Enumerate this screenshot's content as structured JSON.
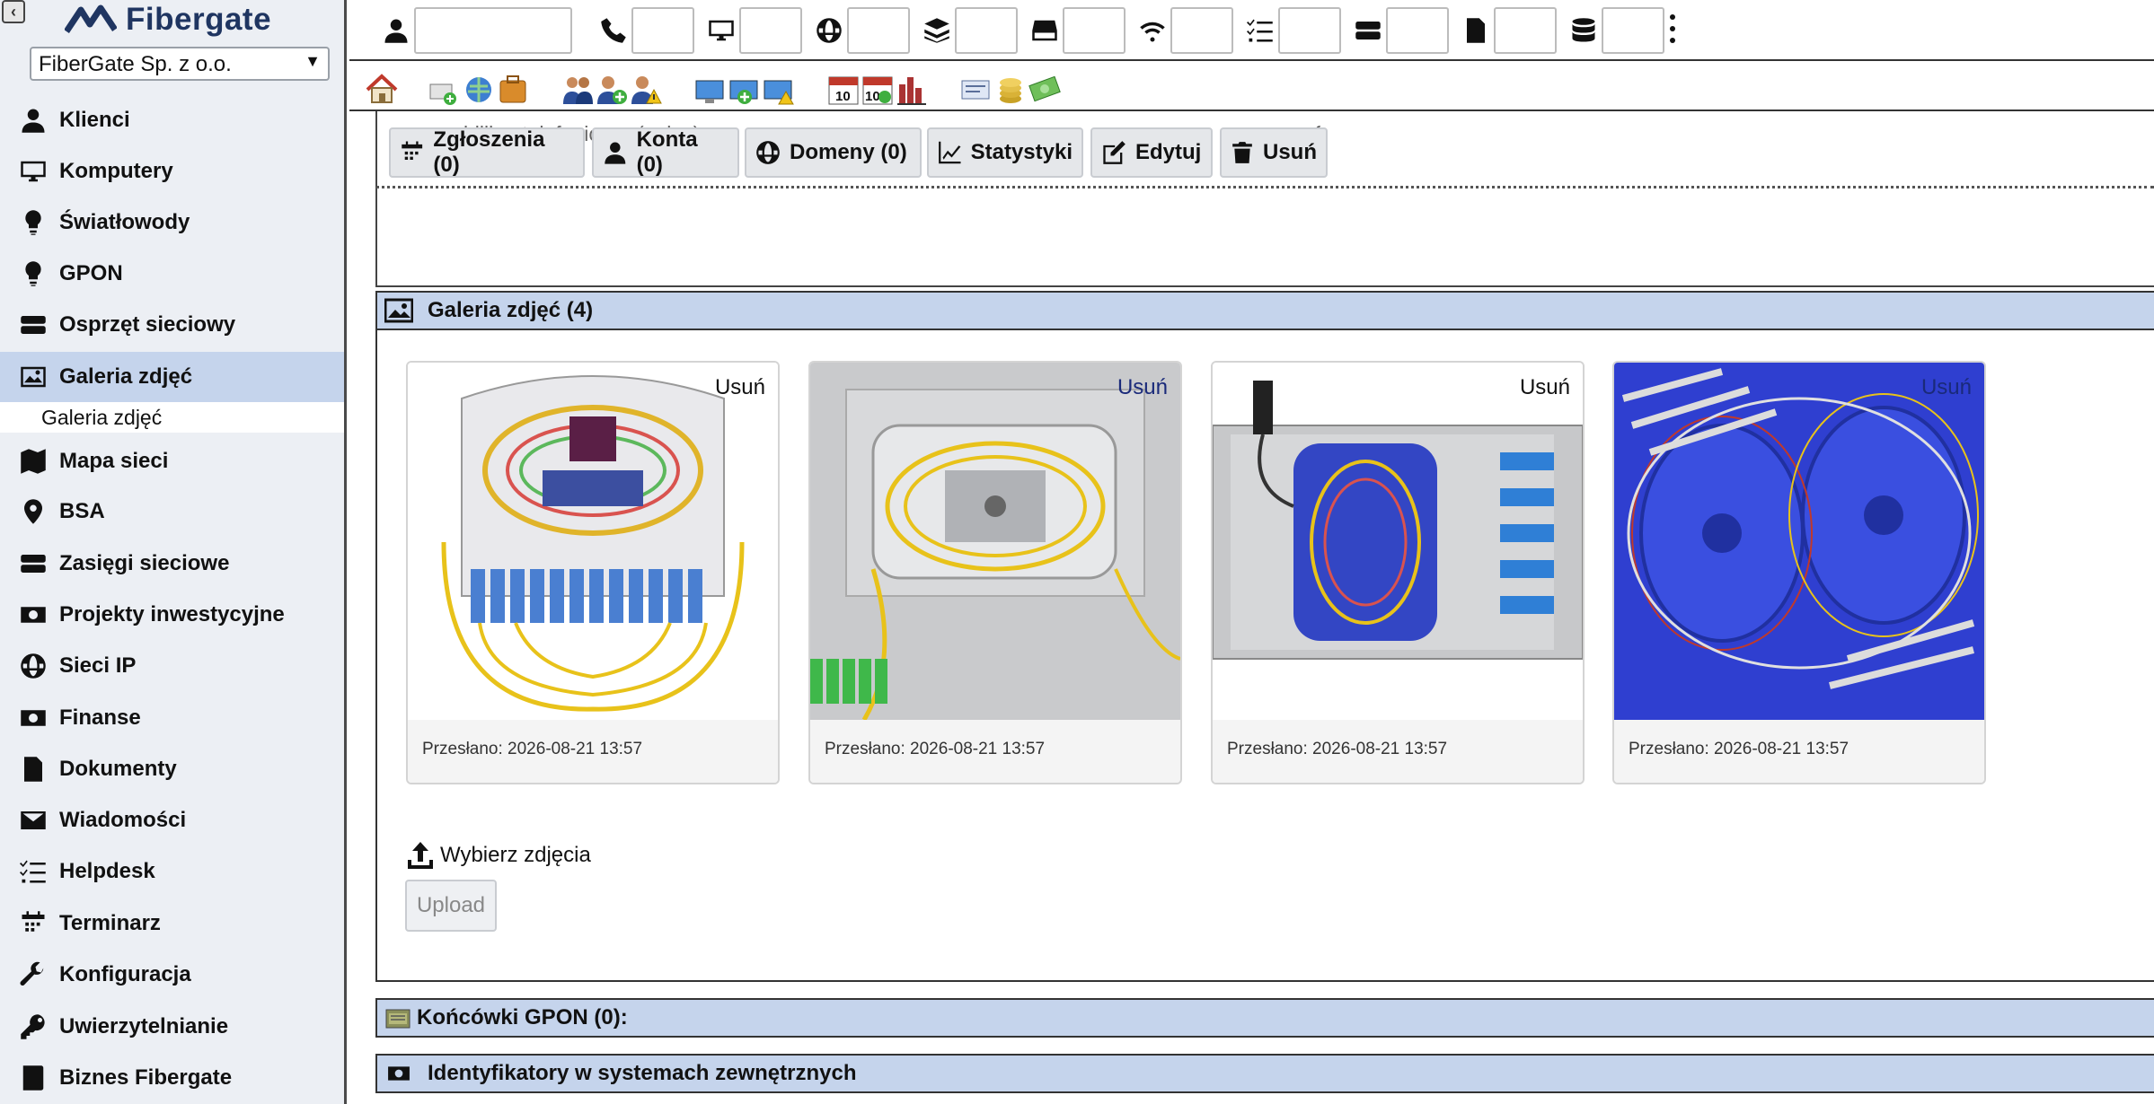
{
  "brand": {
    "name": "Fibergate",
    "collapse_icon": "collapse-left-icon"
  },
  "company_select": {
    "value": "FiberGate Sp. z o.o."
  },
  "sidebar": {
    "items": [
      {
        "label": "Klienci",
        "icon": "user-icon"
      },
      {
        "label": "Komputery",
        "icon": "monitor-icon"
      },
      {
        "label": "Światłowody",
        "icon": "bulb-icon"
      },
      {
        "label": "GPON",
        "icon": "bulb-icon"
      },
      {
        "label": "Osprzęt sieciowy",
        "icon": "server-icon"
      },
      {
        "label": "Galeria zdjęć",
        "icon": "image-icon",
        "active": true
      },
      {
        "label": "Mapa sieci",
        "icon": "map-icon"
      },
      {
        "label": "BSA",
        "icon": "pin-icon"
      },
      {
        "label": "Zasięgi sieciowe",
        "icon": "server-icon"
      },
      {
        "label": "Projekty inwestycyjne",
        "icon": "money-icon"
      },
      {
        "label": "Sieci IP",
        "icon": "globe-icon"
      },
      {
        "label": "Finanse",
        "icon": "money-icon"
      },
      {
        "label": "Dokumenty",
        "icon": "document-icon"
      },
      {
        "label": "Wiadomości",
        "icon": "envelope-icon"
      },
      {
        "label": "Helpdesk",
        "icon": "checklist-icon"
      },
      {
        "label": "Terminarz",
        "icon": "calendar-icon"
      },
      {
        "label": "Konfiguracja",
        "icon": "wrench-icon"
      },
      {
        "label": "Uwierzytelnianie",
        "icon": "key-icon"
      },
      {
        "label": "Biznes Fibergate",
        "icon": "book-icon"
      }
    ],
    "subitem": "Galeria zdjęć"
  },
  "topbar": {
    "fields": [
      {
        "icon": "user-icon",
        "value": ""
      },
      {
        "icon": "phone-icon",
        "value": ""
      },
      {
        "icon": "monitor-icon",
        "value": ""
      },
      {
        "icon": "globe-icon",
        "value": ""
      },
      {
        "icon": "layers-icon",
        "value": ""
      },
      {
        "icon": "hdd-icon",
        "value": ""
      },
      {
        "icon": "wifi-icon",
        "value": ""
      },
      {
        "icon": "checklist-icon",
        "value": ""
      },
      {
        "icon": "server-icon",
        "value": ""
      },
      {
        "icon": "document-icon",
        "value": ""
      },
      {
        "icon": "database-icon",
        "value": ""
      }
    ],
    "more_icon": "more-vertical-icon"
  },
  "quickbar": {
    "icons": [
      "home-icon",
      "add-network-icon",
      "customers-icon",
      "network-computers-icon",
      "calendar-stats-icon",
      "finance-icon"
    ]
  },
  "billing": {
    "label": "billing telefoniczny (pełny)",
    "checked_icon": "check-icon"
  },
  "actions": [
    {
      "label": "Zgłoszenia (0)",
      "icon": "calendar-icon"
    },
    {
      "label": "Konta (0)",
      "icon": "user-icon"
    },
    {
      "label": "Domeny (0)",
      "icon": "globe-icon"
    },
    {
      "label": "Statystyki",
      "icon": "chart-icon"
    },
    {
      "label": "Edytuj",
      "icon": "edit-icon"
    },
    {
      "label": "Usuń",
      "icon": "trash-icon"
    }
  ],
  "gallery": {
    "title": "Galeria zdjęć (4)",
    "photos": [
      {
        "delete_label": "Usuń",
        "uploaded": "Przesłano: 2026-08-21 13:57"
      },
      {
        "delete_label": "Usuń",
        "uploaded": "Przesłano: 2026-08-21 13:57"
      },
      {
        "delete_label": "Usuń",
        "uploaded": "Przesłano: 2026-08-21 13:57"
      },
      {
        "delete_label": "Usuń",
        "uploaded": "Przesłano: 2026-08-21 13:57"
      }
    ],
    "pick_label": "Wybierz zdjęcia",
    "upload_label": "Upload"
  },
  "sections": [
    {
      "title": "Końcówki GPON (0):"
    },
    {
      "title": "Identyfikatory w systemach zewnętrznych"
    }
  ],
  "colors": {
    "nav_active": "#c5d4ec",
    "sidebar_bg": "#eceff4",
    "brand": "#1f3561"
  }
}
